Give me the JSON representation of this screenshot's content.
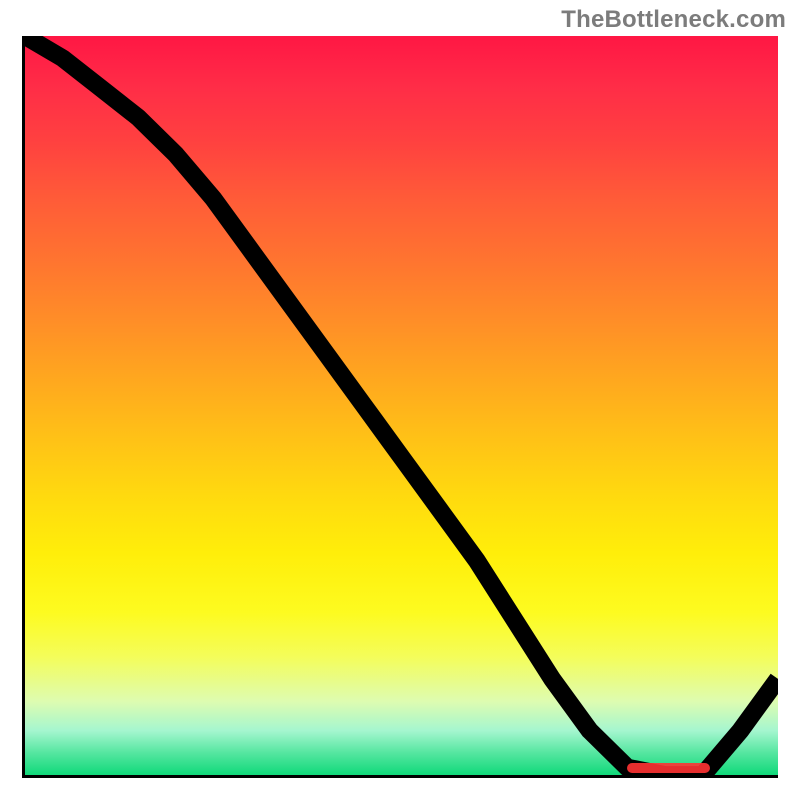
{
  "attribution": "TheBottleneck.com",
  "chart_data": {
    "type": "line",
    "title": "",
    "xlabel": "",
    "ylabel": "",
    "xlim": [
      0,
      100
    ],
    "ylim": [
      0,
      100
    ],
    "x": [
      0,
      5,
      10,
      15,
      20,
      25,
      30,
      35,
      40,
      45,
      50,
      55,
      60,
      65,
      70,
      75,
      80,
      85,
      90,
      95,
      100
    ],
    "values": [
      100,
      97,
      93,
      89,
      84,
      78,
      71,
      64,
      57,
      50,
      43,
      36,
      29,
      21,
      13,
      6,
      1,
      0,
      0,
      6,
      13
    ],
    "highlight_band_x": [
      80,
      91
    ],
    "gradient": [
      "#ff1744",
      "#ffd90f",
      "#10d97a"
    ]
  }
}
